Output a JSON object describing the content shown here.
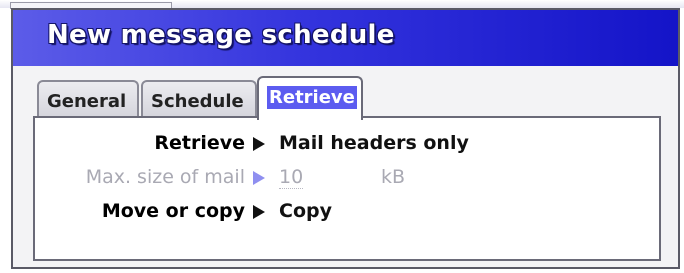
{
  "dialog": {
    "title": "New message schedule"
  },
  "tabs": [
    {
      "label": "General",
      "active": false
    },
    {
      "label": "Schedule",
      "active": false
    },
    {
      "label": "Retrieve",
      "active": true
    }
  ],
  "fields": {
    "retrieve": {
      "label": "Retrieve",
      "value": "Mail headers only"
    },
    "max_size": {
      "label": "Max. size of mail",
      "value": "10",
      "unit": "kB",
      "enabled": false
    },
    "move_or_copy": {
      "label": "Move or copy",
      "value": "Copy"
    }
  },
  "colors": {
    "titlebar_accent": "#1414c8",
    "selected_tab_highlight": "#5c5cf0",
    "disabled_text": "#a9a9b3"
  }
}
